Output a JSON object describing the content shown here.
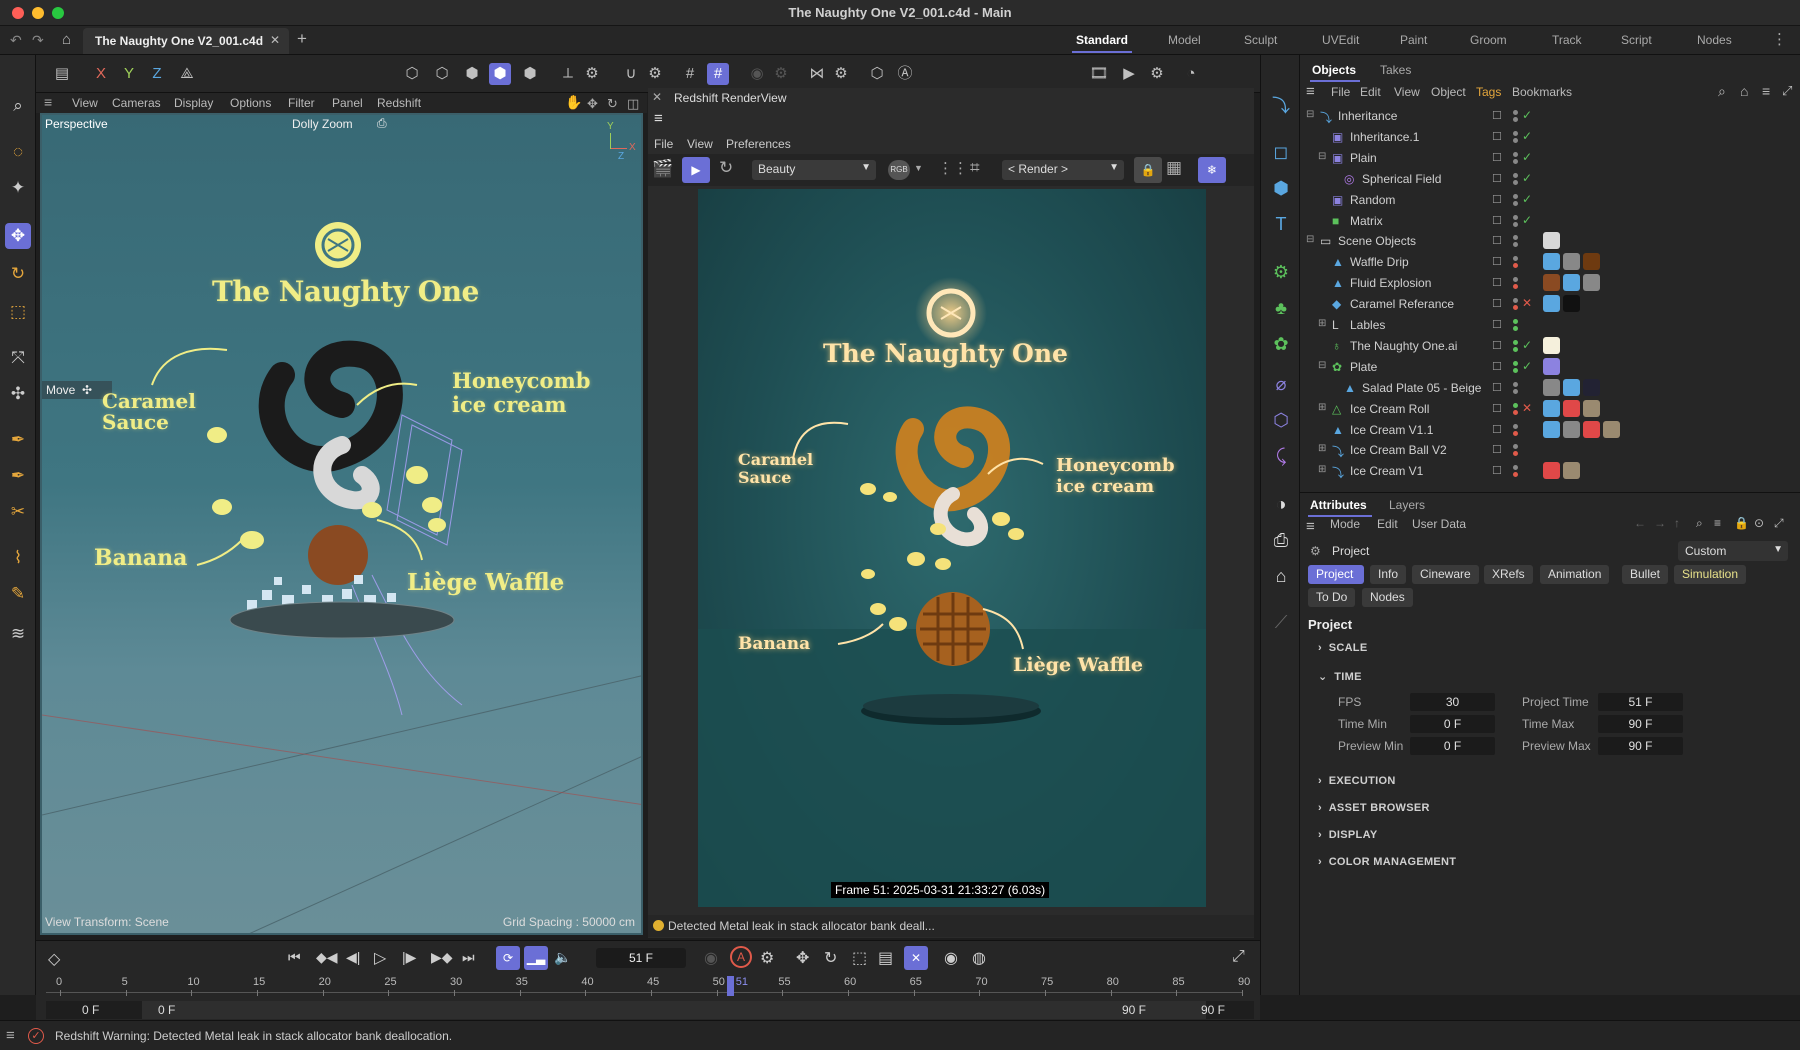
{
  "window": {
    "title": "The Naughty One V2_001.c4d - Main"
  },
  "tabs": {
    "doc_tab": "The Naughty One V2_001.c4d"
  },
  "layouts": [
    "Standard",
    "Model",
    "Sculpt",
    "UVEdit",
    "Paint",
    "Groom",
    "Track",
    "Script",
    "Nodes"
  ],
  "axis_toggles": [
    "X",
    "Y",
    "Z"
  ],
  "viewport": {
    "menu": [
      "View",
      "Cameras",
      "Display",
      "Options",
      "Filter",
      "Panel",
      "Redshift"
    ],
    "camera_label": "Perspective",
    "dolly_label": "Dolly Zoom",
    "move_label": "Move",
    "view_transform": "View Transform: Scene",
    "grid_spacing": "Grid Spacing : 50000 cm",
    "axis_y": "Y",
    "axis_x": "X",
    "axis_z": "Z"
  },
  "artwork": {
    "brand": "The Naughty One",
    "labels": {
      "caramel": "Caramel\nSauce",
      "honeycomb": "Honeycomb\nice cream",
      "banana": "Banana",
      "waffle": "Liège Waffle"
    }
  },
  "renderview": {
    "title": "Redshift RenderView",
    "menu": [
      "File",
      "View",
      "Preferences"
    ],
    "aov": "Beauty",
    "render_target": "< Render >",
    "frame_info": "Frame  51:  2025-03-31  21:33:27  (6.03s)",
    "status_msg": "Detected Metal leak in stack allocator bank deall..."
  },
  "objects_panel": {
    "tabs": [
      "Objects",
      "Takes"
    ],
    "menu": [
      "File",
      "Edit",
      "View",
      "Object",
      "Tags",
      "Bookmarks"
    ],
    "rows": [
      {
        "name": "Inheritance",
        "indent": 0,
        "expand": "minus",
        "icon": "inheritance-icon",
        "icon_glyph": "⤵",
        "icon_color": "#5aa7e0",
        "check": "check",
        "dots": [
          "#888",
          "#888"
        ]
      },
      {
        "name": "Inheritance.1",
        "indent": 1,
        "expand": "",
        "icon": "effector-icon",
        "icon_glyph": "▣",
        "icon_color": "#8c82e0",
        "check": "check",
        "dots": [
          "#888",
          "#888"
        ]
      },
      {
        "name": "Plain",
        "indent": 1,
        "expand": "minus",
        "icon": "plain-effector-icon",
        "icon_glyph": "▣",
        "icon_color": "#8c82e0",
        "check": "check",
        "dots": [
          "#888",
          "#888"
        ]
      },
      {
        "name": "Spherical Field",
        "indent": 2,
        "expand": "",
        "icon": "spherical-field-icon",
        "icon_glyph": "◎",
        "icon_color": "#b07ae8",
        "check": "check",
        "dots": [
          "#888",
          "#888"
        ]
      },
      {
        "name": "Random",
        "indent": 1,
        "expand": "",
        "icon": "random-effector-icon",
        "icon_glyph": "▣",
        "icon_color": "#8c82e0",
        "check": "check",
        "dots": [
          "#888",
          "#888"
        ]
      },
      {
        "name": "Matrix",
        "indent": 1,
        "expand": "",
        "icon": "matrix-icon",
        "icon_glyph": "■",
        "icon_color": "#5cc15c",
        "check": "check",
        "dots": [
          "#888",
          "#888"
        ]
      },
      {
        "name": "Scene Objects",
        "indent": 0,
        "expand": "minus",
        "icon": "folder-icon",
        "icon_glyph": "▭",
        "icon_color": "#cfcfcf",
        "check": "",
        "dots": [
          "#888",
          "#888"
        ]
      },
      {
        "name": "Waffle Drip",
        "indent": 1,
        "expand": "",
        "icon": "mesh-icon",
        "icon_glyph": "▲",
        "icon_color": "#5aa7e0",
        "check": "",
        "dots": [
          "#888",
          "#e05a4a"
        ]
      },
      {
        "name": "Fluid Explosion",
        "indent": 1,
        "expand": "",
        "icon": "mesh-icon",
        "icon_glyph": "▲",
        "icon_color": "#5aa7e0",
        "check": "",
        "dots": [
          "#888",
          "#e05a4a"
        ]
      },
      {
        "name": "Caramel Referance",
        "indent": 1,
        "expand": "",
        "icon": "plane-icon",
        "icon_glyph": "◆",
        "icon_color": "#5aa7e0",
        "check": "x",
        "dots": [
          "#888",
          "#e05a4a"
        ]
      },
      {
        "name": "Lables",
        "indent": 1,
        "expand": "plus",
        "icon": "null-icon",
        "icon_glyph": "L",
        "icon_color": "#cfcfcf",
        "check": "",
        "dots": [
          "#5cc15c",
          "#5cc15c"
        ]
      },
      {
        "name": "The Naughty One.ai",
        "indent": 1,
        "expand": "",
        "icon": "spline-icon",
        "icon_glyph": "♁",
        "icon_color": "#5cc15c",
        "check": "check",
        "dots": [
          "#5cc15c",
          "#5cc15c"
        ]
      },
      {
        "name": "Plate",
        "indent": 1,
        "expand": "minus",
        "icon": "cloner-icon",
        "icon_glyph": "✿",
        "icon_color": "#5cc15c",
        "check": "check",
        "dots": [
          "#5cc15c",
          "#5cc15c"
        ]
      },
      {
        "name": "Salad Plate 05 - Beige",
        "indent": 2,
        "expand": "",
        "icon": "mesh-icon",
        "icon_glyph": "▲",
        "icon_color": "#5aa7e0",
        "check": "",
        "dots": [
          "#888",
          "#888"
        ]
      },
      {
        "name": "Ice Cream Roll",
        "indent": 1,
        "expand": "plus",
        "icon": "symmetry-icon",
        "icon_glyph": "△",
        "icon_color": "#5cc15c",
        "check": "x",
        "dots": [
          "#5cc15c",
          "#e05a4a"
        ]
      },
      {
        "name": "Ice Cream V1.1",
        "indent": 1,
        "expand": "",
        "icon": "mesh-icon",
        "icon_glyph": "▲",
        "icon_color": "#5aa7e0",
        "check": "",
        "dots": [
          "#888",
          "#e05a4a"
        ]
      },
      {
        "name": "Ice Cream Ball V2",
        "indent": 1,
        "expand": "plus",
        "icon": "inheritance-icon",
        "icon_glyph": "⤵",
        "icon_color": "#5aa7e0",
        "check": "",
        "dots": [
          "#888",
          "#e05a4a"
        ]
      },
      {
        "name": "Ice Cream V1",
        "indent": 1,
        "expand": "plus",
        "icon": "inheritance-icon",
        "icon_glyph": "⤵",
        "icon_color": "#5aa7e0",
        "check": "",
        "dots": [
          "#888",
          "#e05a4a"
        ]
      }
    ]
  },
  "attributes": {
    "tabs": [
      "Attributes",
      "Layers"
    ],
    "menu": [
      "Mode",
      "Edit",
      "User Data"
    ],
    "object_label": "Project",
    "preset": "Custom",
    "pills": [
      "Project",
      "Info",
      "Cineware",
      "XRefs",
      "Animation",
      "Bullet",
      "Simulation",
      "To Do",
      "Nodes"
    ],
    "heading": "Project",
    "sections": [
      "SCALE",
      "TIME",
      "EXECUTION",
      "ASSET BROWSER",
      "DISPLAY",
      "COLOR MANAGEMENT"
    ],
    "time": {
      "fps_label": "FPS",
      "fps": "30",
      "project_time_label": "Project Time",
      "project_time": "51 F",
      "time_min_label": "Time Min",
      "time_min": "0 F",
      "time_max_label": "Time Max",
      "time_max": "90 F",
      "preview_min_label": "Preview Min",
      "preview_min": "0 F",
      "preview_max_label": "Preview Max",
      "preview_max": "90 F"
    }
  },
  "timeline": {
    "current_frame": "51 F",
    "ruler": [
      "0",
      "5",
      "10",
      "15",
      "20",
      "25",
      "30",
      "35",
      "40",
      "45",
      "50",
      "55",
      "60",
      "65",
      "70",
      "75",
      "80",
      "85",
      "90"
    ],
    "playhead": "51",
    "start_a": "0 F",
    "start_b": "0 F",
    "end_a": "90 F",
    "end_b": "90 F"
  },
  "status": {
    "message": "Redshift Warning: Detected Metal leak in stack allocator bank deallocation."
  },
  "colors": {
    "accent": "#6b6fd6",
    "viewport_bg": "#3f7682",
    "label_yellow": "#f0ed86"
  }
}
